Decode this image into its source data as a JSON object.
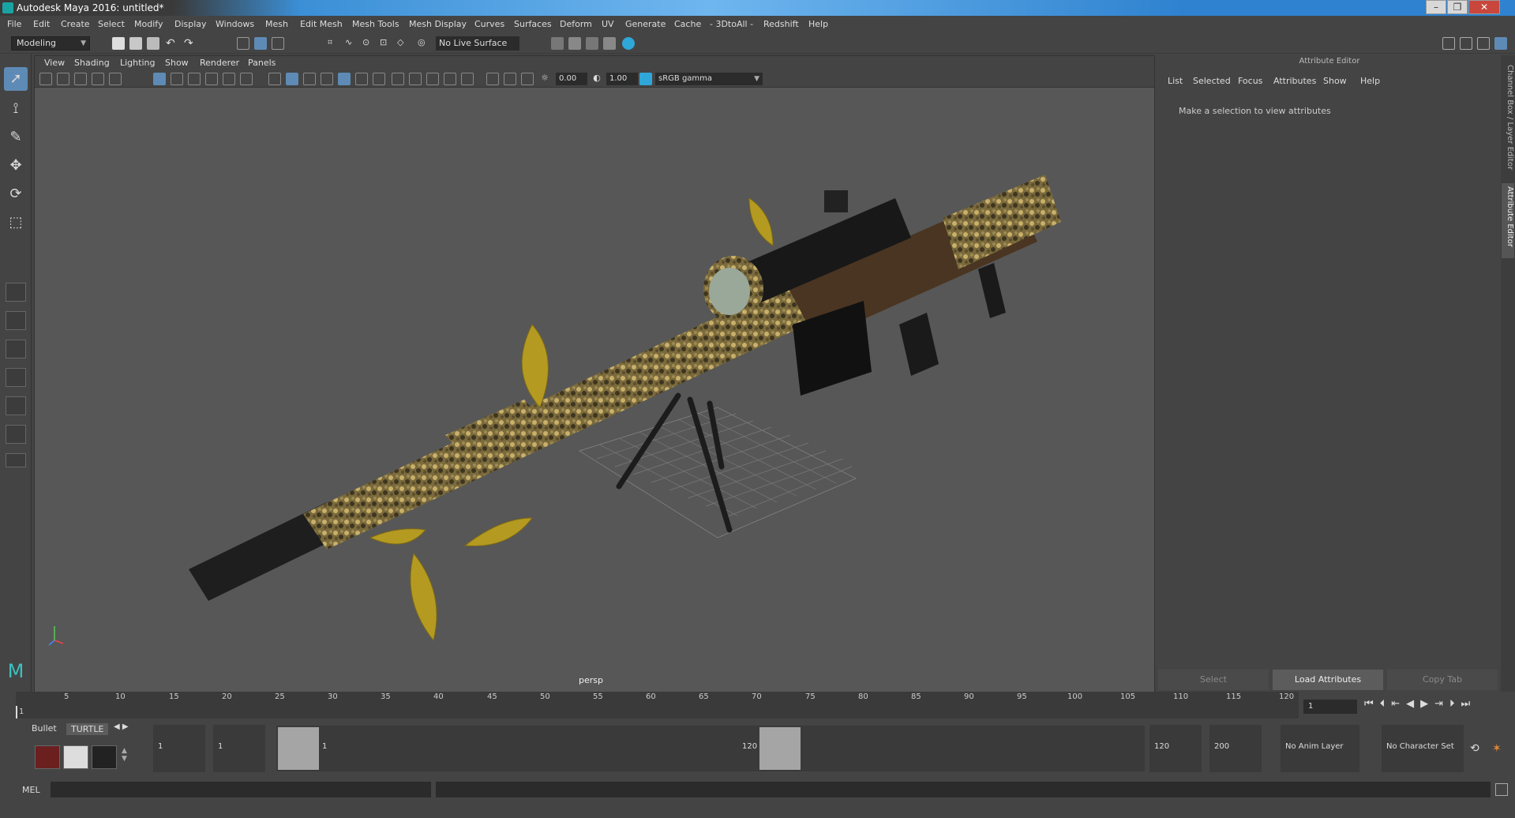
{
  "window": {
    "title": "Autodesk Maya 2016: untitled*",
    "min": "–",
    "max": "❐",
    "close": "✕"
  },
  "menubar": [
    "File",
    "Edit",
    "Create",
    "Select",
    "Modify",
    "Display",
    "Windows",
    "Mesh",
    "Edit Mesh",
    "Mesh Tools",
    "Mesh Display",
    "Curves",
    "Surfaces",
    "Deform",
    "UV",
    "Generate",
    "Cache",
    "- 3DtoAll -",
    "Redshift",
    "Help"
  ],
  "shelf": {
    "mode": "Modeling",
    "live_surface": "No Live Surface"
  },
  "viewport": {
    "menu": [
      "View",
      "Shading",
      "Lighting",
      "Show",
      "Renderer",
      "Panels"
    ],
    "exposure": "0.00",
    "gamma": "1.00",
    "colorspace": "sRGB gamma",
    "camera_label": "persp"
  },
  "attribute_editor": {
    "title": "Attribute Editor",
    "menu": [
      "List",
      "Selected",
      "Focus",
      "Attributes",
      "Show",
      "Help"
    ],
    "message": "Make a selection to view attributes",
    "buttons": {
      "select": "Select",
      "load": "Load Attributes",
      "copy": "Copy Tab"
    },
    "side_tabs": [
      "Channel Box / Layer Editor",
      "Attribute Editor"
    ]
  },
  "timeline": {
    "ticks": [
      "1",
      "5",
      "10",
      "15",
      "20",
      "25",
      "30",
      "35",
      "40",
      "45",
      "50",
      "55",
      "60",
      "65",
      "70",
      "75",
      "80",
      "85",
      "90",
      "95",
      "100",
      "105",
      "110",
      "115",
      "120"
    ],
    "current_frame": "1"
  },
  "range": {
    "shelf_tabs": [
      "Bullet",
      "TURTLE"
    ],
    "start": "1",
    "playback_start": "1",
    "handle_start": "1",
    "handle_end": "120",
    "playback_end": "120",
    "end": "200",
    "anim_layer": "No Anim Layer",
    "character_set": "No Character Set"
  },
  "command_line": {
    "label": "MEL"
  }
}
